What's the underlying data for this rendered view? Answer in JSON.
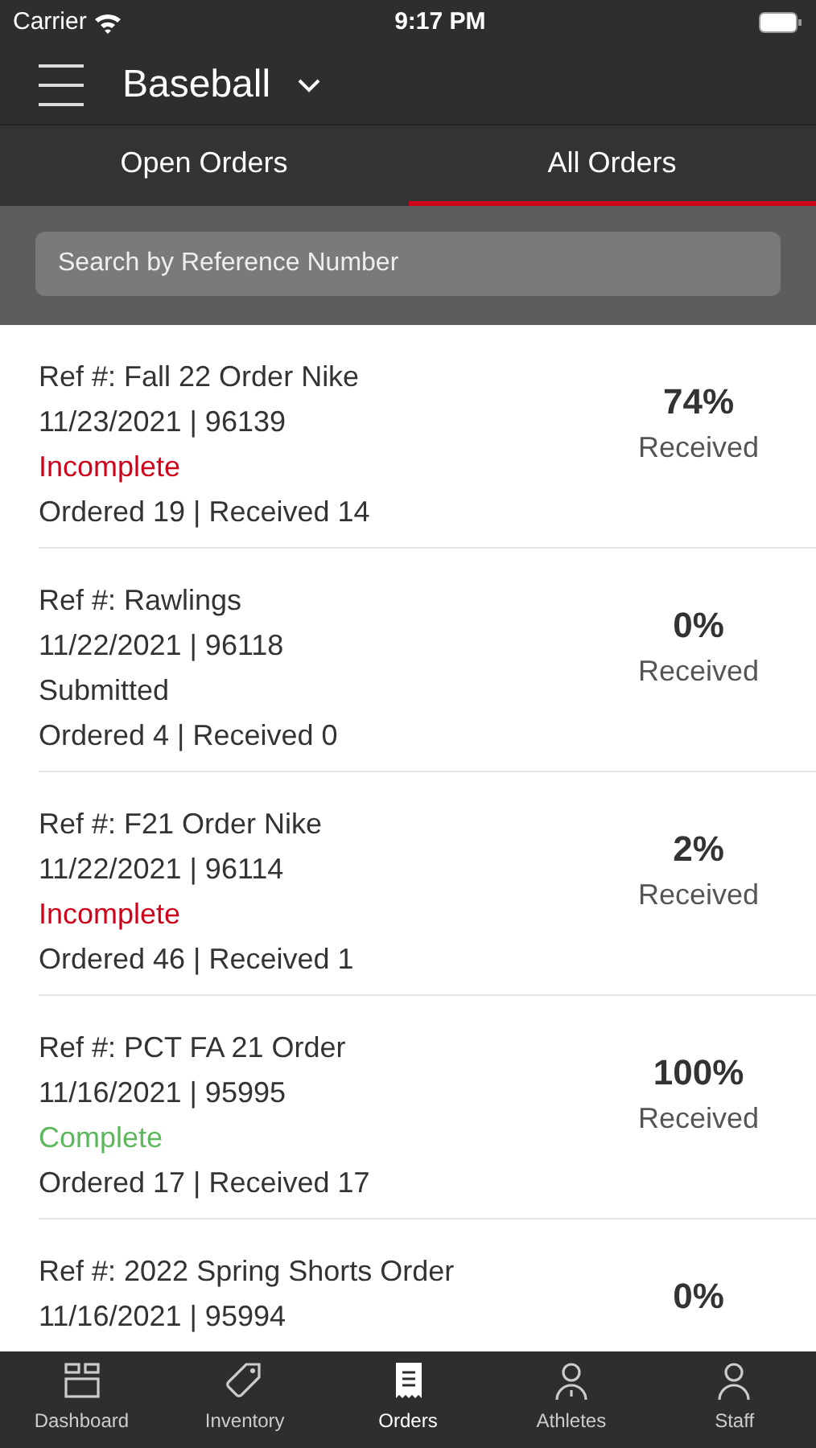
{
  "status_bar": {
    "carrier": "Carrier",
    "time": "9:17 PM"
  },
  "header": {
    "title": "Baseball"
  },
  "tabs": [
    {
      "label": "Open Orders",
      "selected": false
    },
    {
      "label": "All Orders",
      "selected": true
    }
  ],
  "search": {
    "placeholder": "Search by Reference Number"
  },
  "orders": [
    {
      "ref": "Ref #: Fall 22 Order Nike",
      "date_id": "11/23/2021 | 96139",
      "status": "Incomplete",
      "kind": "incomplete",
      "counts": "Ordered 19 | Received 14",
      "percent": "74%",
      "percent_label": "Received"
    },
    {
      "ref": "Ref #: Rawlings",
      "date_id": "11/22/2021 | 96118",
      "status": "Submitted",
      "kind": "submitted",
      "counts": "Ordered 4 | Received 0",
      "percent": "0%",
      "percent_label": "Received"
    },
    {
      "ref": "Ref #: F21 Order Nike",
      "date_id": "11/22/2021 | 96114",
      "status": "Incomplete",
      "kind": "incomplete",
      "counts": "Ordered 46 | Received 1",
      "percent": "2%",
      "percent_label": "Received"
    },
    {
      "ref": "Ref #: PCT FA 21 Order",
      "date_id": "11/16/2021 | 95995",
      "status": "Complete",
      "kind": "complete",
      "counts": "Ordered 17 | Received 17",
      "percent": "100%",
      "percent_label": "Received"
    },
    {
      "ref": "Ref #: 2022 Spring Shorts Order",
      "date_id": "11/16/2021 | 95994",
      "percent": "0%"
    }
  ],
  "tab_bar": [
    {
      "kind": "dashboard",
      "label": "Dashboard",
      "selected": false
    },
    {
      "kind": "inventory",
      "label": "Inventory",
      "selected": false
    },
    {
      "kind": "orders",
      "label": "Orders",
      "selected": true
    },
    {
      "kind": "athletes",
      "label": "Athletes",
      "selected": false
    },
    {
      "kind": "staff",
      "label": "Staff",
      "selected": false
    }
  ]
}
